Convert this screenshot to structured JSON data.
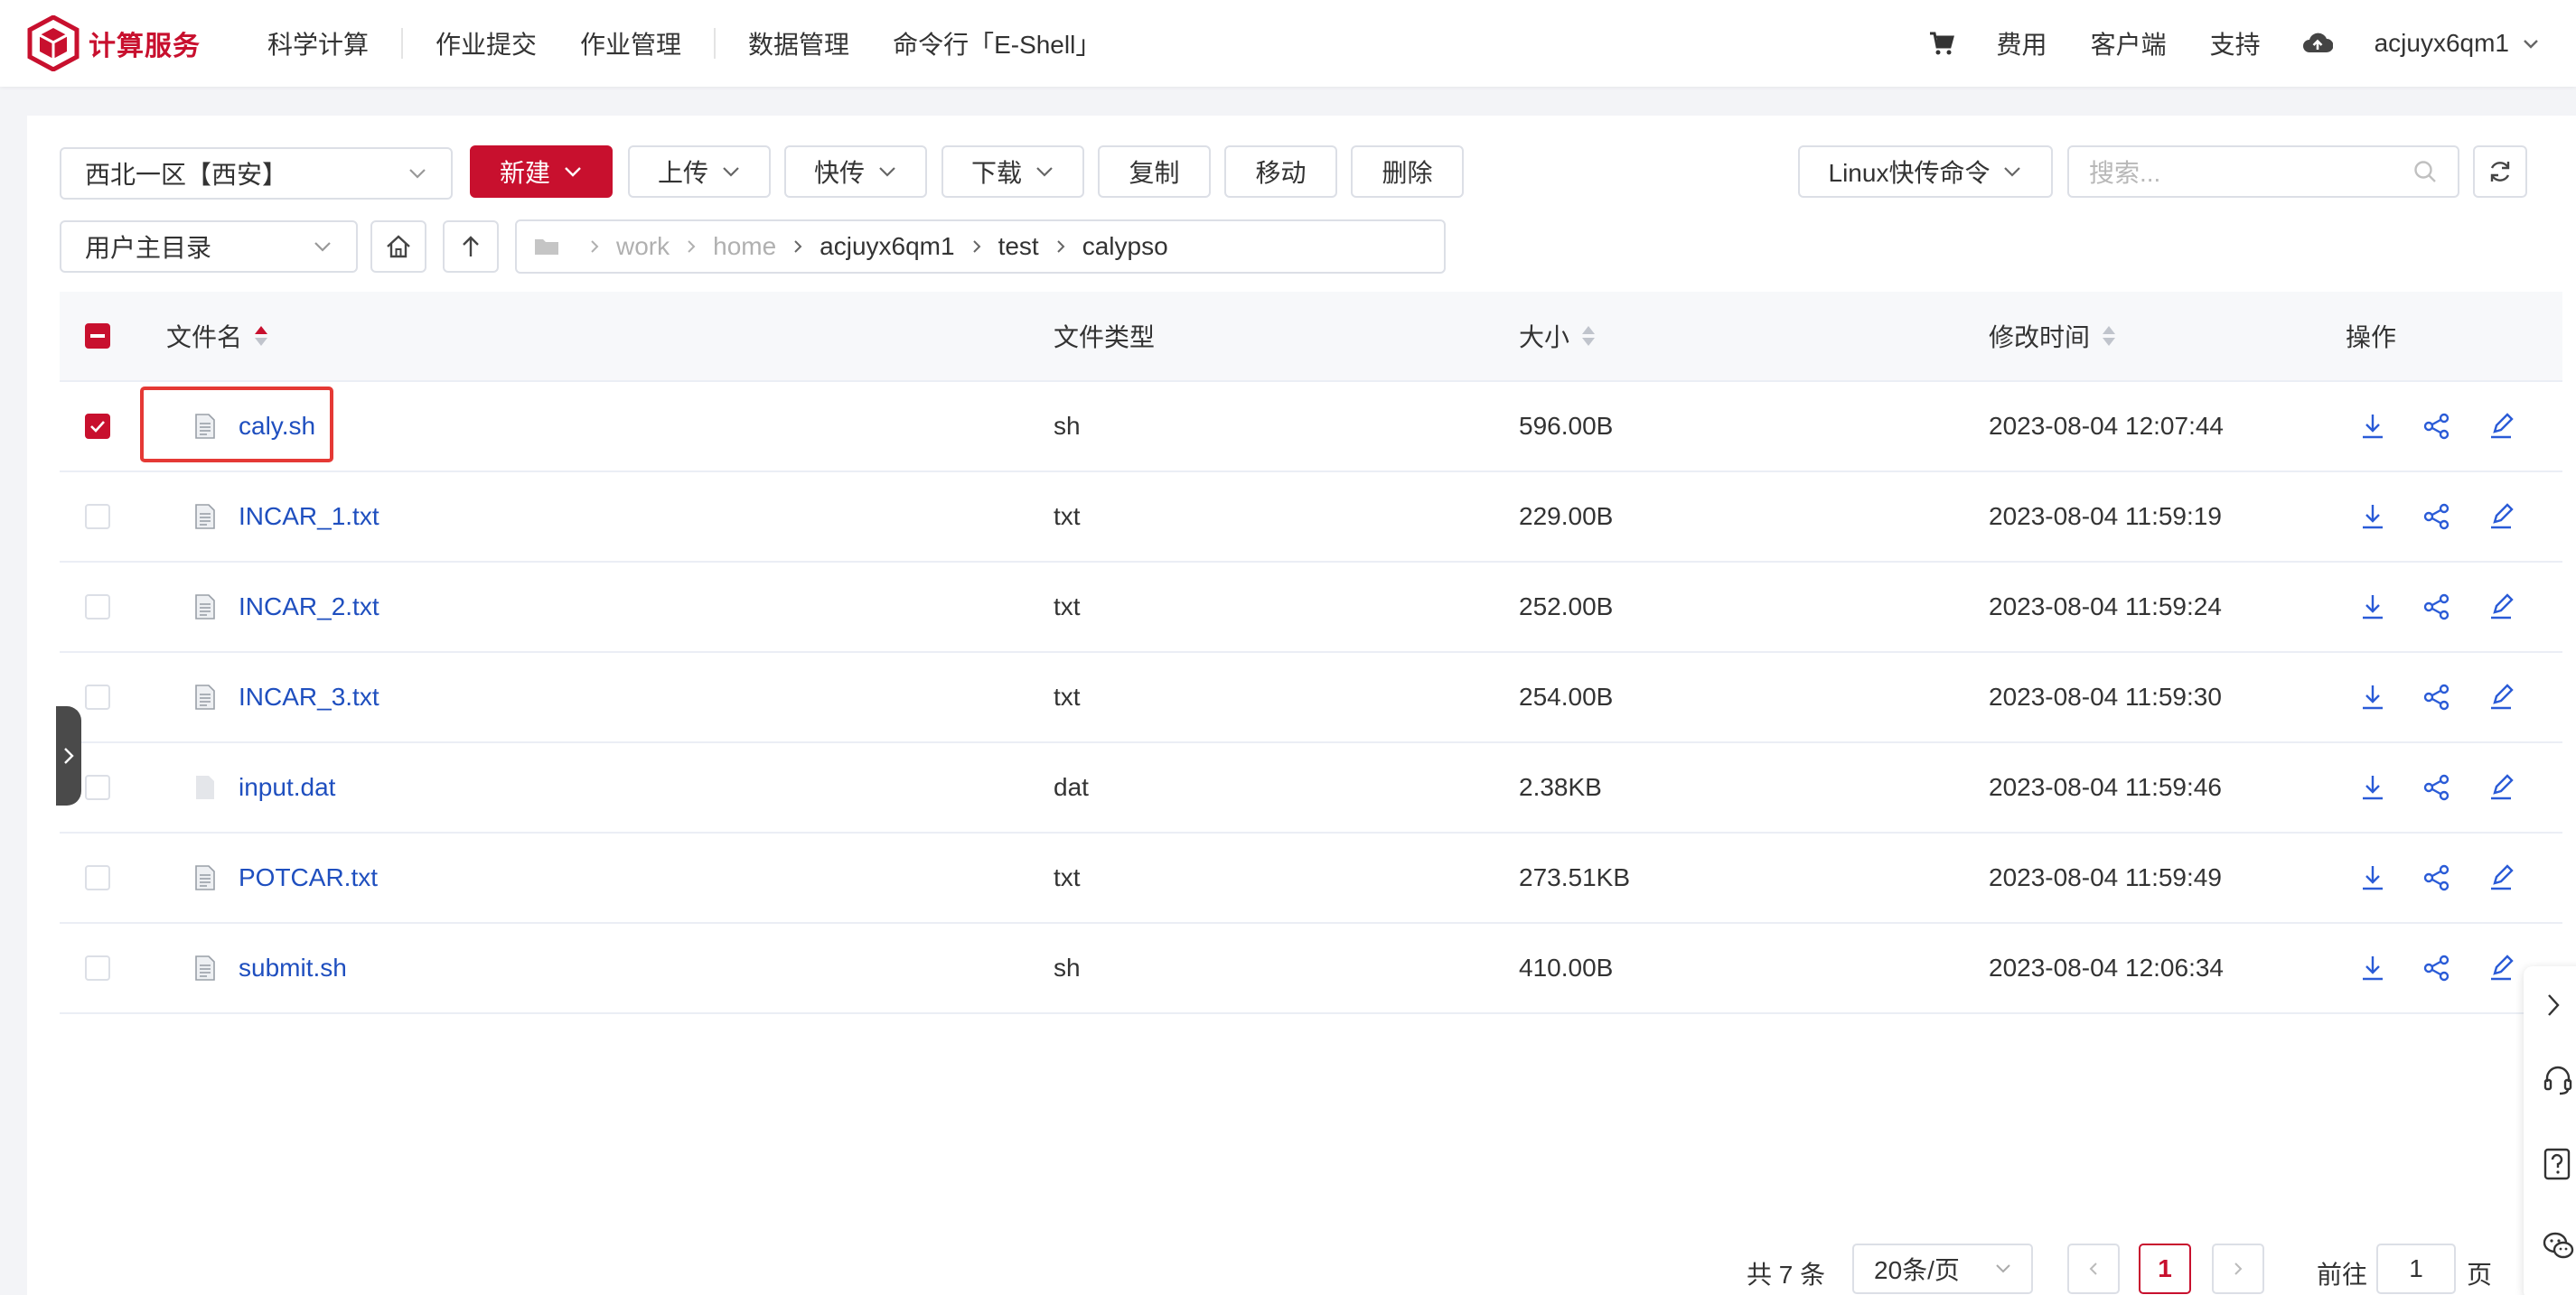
{
  "header": {
    "brand": "计算服务",
    "nav": [
      "科学计算",
      "作业提交",
      "作业管理",
      "数据管理",
      "命令行「E-Shell」"
    ],
    "right": {
      "fees": "费用",
      "client": "客户端",
      "support": "支持",
      "username": "acjuyx6qm1"
    }
  },
  "toolbar": {
    "region": "西北一区【西安】",
    "new_label": "新建",
    "upload_label": "上传",
    "fast_label": "快传",
    "download_label": "下载",
    "copy_label": "复制",
    "move_label": "移动",
    "delete_label": "删除",
    "linux_cmd": "Linux快传命令",
    "search_placeholder": "搜索..."
  },
  "pathbar": {
    "dir_select": "用户主目录",
    "crumbs": [
      "work",
      "home",
      "acjuyx6qm1",
      "test",
      "calypso"
    ]
  },
  "table": {
    "headers": {
      "name": "文件名",
      "type": "文件类型",
      "size": "大小",
      "mtime": "修改时间",
      "ops": "操作"
    },
    "rows": [
      {
        "name": "caly.sh",
        "type": "sh",
        "size": "596.00B",
        "mtime": "2023-08-04 12:07:44",
        "checked": true
      },
      {
        "name": "INCAR_1.txt",
        "type": "txt",
        "size": "229.00B",
        "mtime": "2023-08-04 11:59:19",
        "checked": false
      },
      {
        "name": "INCAR_2.txt",
        "type": "txt",
        "size": "252.00B",
        "mtime": "2023-08-04 11:59:24",
        "checked": false
      },
      {
        "name": "INCAR_3.txt",
        "type": "txt",
        "size": "254.00B",
        "mtime": "2023-08-04 11:59:30",
        "checked": false
      },
      {
        "name": "input.dat",
        "type": "dat",
        "size": "2.38KB",
        "mtime": "2023-08-04 11:59:46",
        "checked": false
      },
      {
        "name": "POTCAR.txt",
        "type": "txt",
        "size": "273.51KB",
        "mtime": "2023-08-04 11:59:49",
        "checked": false
      },
      {
        "name": "submit.sh",
        "type": "sh",
        "size": "410.00B",
        "mtime": "2023-08-04 12:06:34",
        "checked": false
      }
    ]
  },
  "pagination": {
    "total_text": "共 7 条",
    "page_size": "20条/页",
    "current_page": "1",
    "goto_prefix": "前往",
    "goto_value": "1",
    "goto_suffix": "页"
  },
  "colors": {
    "brand": "#c8102e",
    "link": "#1f4fbf",
    "highlight": "#e53935"
  }
}
